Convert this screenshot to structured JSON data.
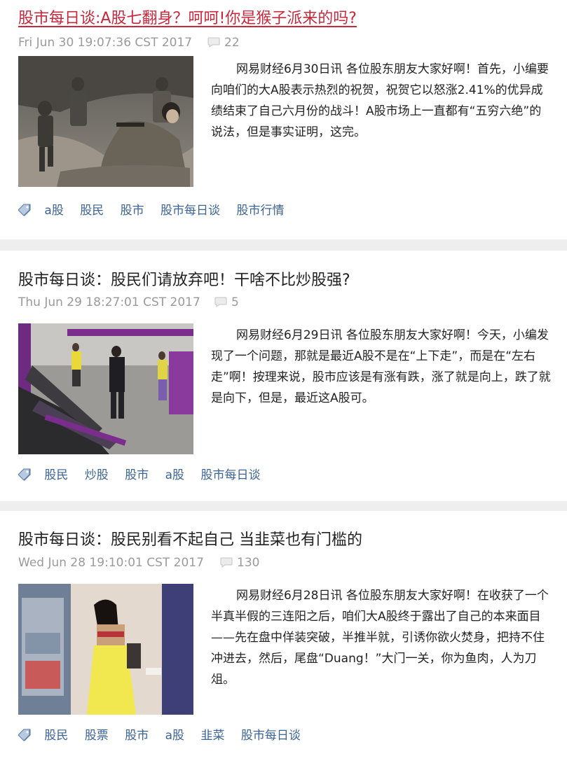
{
  "posts": [
    {
      "title": "股市每日谈:A股七翻身？呵呵!你是猴子派来的吗?",
      "date": "Fri Jun 30 19:07:36 CST 2017",
      "comments": "22",
      "excerpt": "网易财经6月30日讯 各位股东朋友大家好啊！首先，小编要向咱们的大A股表示热烈的祝贺，祝贺它以怒涨2.41%的优异成绩结束了自己六月份的战斗！A股市场上一直都有“五穷六绝”的说法，但是事实证明，这完。",
      "tags": [
        "a股",
        "股民",
        "股市",
        "股市每日谈",
        "股市行情"
      ]
    },
    {
      "title": "股市每日谈：股民们请放弃吧！干啥不比炒股强?",
      "date": "Thu Jun 29 18:27:01 CST 2017",
      "comments": "5",
      "excerpt": "网易财经6月29日讯 各位股东朋友大家好啊！今天，小编发现了一个问题，那就是最近A股不是在“上下走”，而是在“左右走”啊！按理来说，股市应该是有涨有跌，涨了就是向上，跌了就是向下，但是，最近这A股可。",
      "tags": [
        "股民",
        "炒股",
        "股市",
        "a股",
        "股市每日谈"
      ]
    },
    {
      "title": "股市每日谈：股民别看不起自己 当韭菜也有门槛的",
      "date": "Wed Jun 28 19:10:01 CST 2017",
      "comments": "130",
      "excerpt": "网易财经6月28日讯 各位股东朋友大家好啊！在收获了一个半真半假的三连阳之后，咱们大A股终于露出了自己的本来面目——先在盘中佯装突破，半推半就，引诱你欲火焚身，把持不住冲进去，然后，尾盘“Duang！”大门一关，你为鱼肉，人为刀俎。",
      "tags": [
        "股民",
        "股票",
        "股市",
        "a股",
        "韭菜",
        "股市每日谈"
      ]
    }
  ]
}
